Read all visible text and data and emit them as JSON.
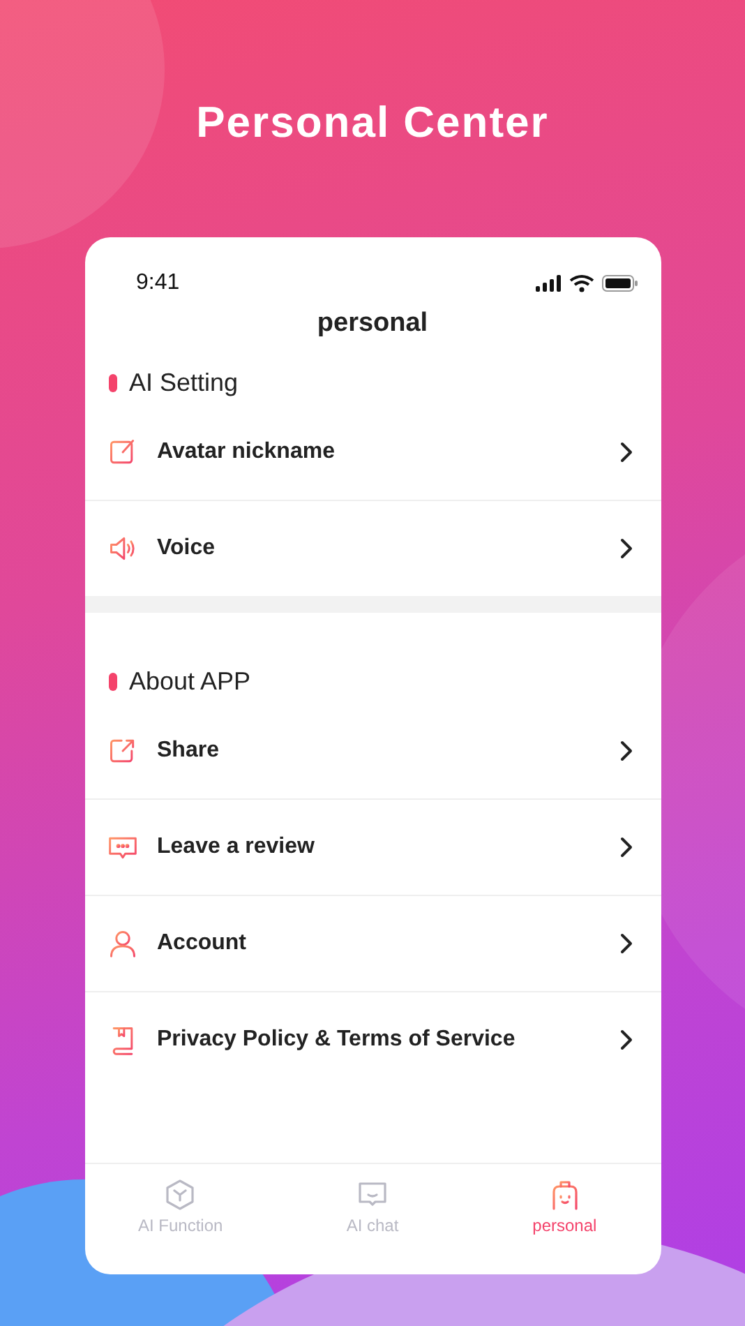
{
  "title": "Personal Center",
  "status_bar": {
    "time": "9:41"
  },
  "nav_title": "personal",
  "sections": [
    {
      "title": "AI Setting",
      "items": [
        {
          "label": "Avatar nickname"
        },
        {
          "label": "Voice"
        }
      ]
    },
    {
      "title": "About APP",
      "items": [
        {
          "label": "Share"
        },
        {
          "label": "Leave a review"
        },
        {
          "label": "Account"
        },
        {
          "label": "Privacy Policy & Terms of Service"
        }
      ]
    }
  ],
  "tabs": [
    {
      "label": "AI Function",
      "selected": false
    },
    {
      "label": "AI chat",
      "selected": false
    },
    {
      "label": "personal",
      "selected": true
    }
  ]
}
